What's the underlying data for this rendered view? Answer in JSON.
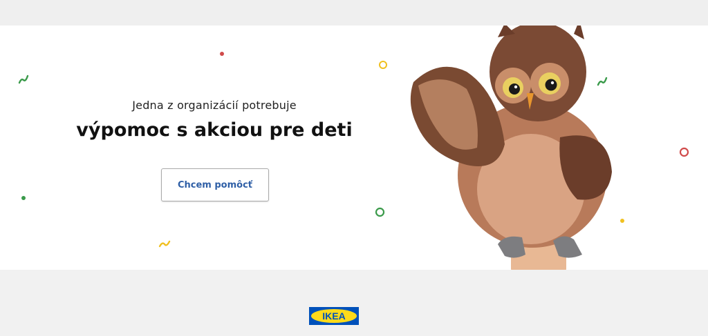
{
  "banner": {
    "subtitle": "Jedna z organizácií potrebuje",
    "headline": "výpomoc s akciou pre deti",
    "cta_label": "Chcem pomôcť"
  },
  "footer": {
    "logo_text": "IKEA"
  },
  "colors": {
    "cta_text": "#2f5fa6",
    "logo_blue": "#0051ba",
    "logo_yellow": "#ffda1a",
    "confetti_green": "#3a9a4a",
    "confetti_red": "#d04a4a",
    "confetti_yellow": "#f0c020"
  },
  "icons": [
    "owl-puppet-image",
    "confetti-decoration",
    "ikea-logo"
  ]
}
